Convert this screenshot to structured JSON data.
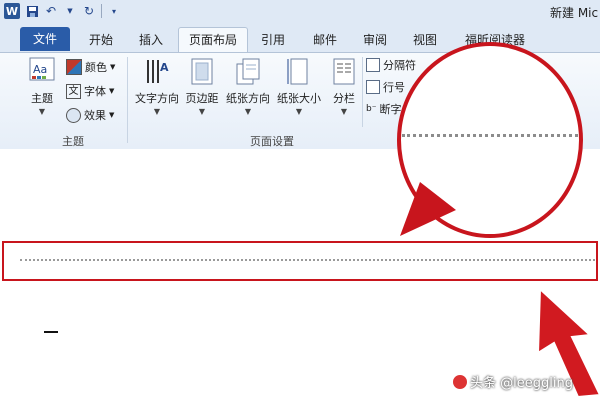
{
  "titlebar": {
    "app_icon_letter": "W",
    "window_title": "新建 Mic"
  },
  "tabs": {
    "file": "文件",
    "items": [
      "开始",
      "插入",
      "页面布局",
      "引用",
      "邮件",
      "审阅",
      "视图",
      "福昕阅读器"
    ],
    "active_index": 2
  },
  "ribbon": {
    "theme_group": {
      "label": "主题",
      "theme_button": "主题",
      "colors": "颜色",
      "fonts": "字体",
      "effects": "效果"
    },
    "page_setup_group": {
      "label": "页面设置",
      "text_direction": "文字方向",
      "margins": "页边距",
      "orientation": "纸张方向",
      "size": "纸张大小",
      "columns": "分栏",
      "breaks": "分隔符",
      "line_numbers": "行号",
      "hyphenation": "断字"
    }
  },
  "watermark": {
    "text": "头条 @leeggling"
  },
  "colors": {
    "highlight_red": "#c8151d",
    "file_tab_blue": "#2a5ca8"
  }
}
